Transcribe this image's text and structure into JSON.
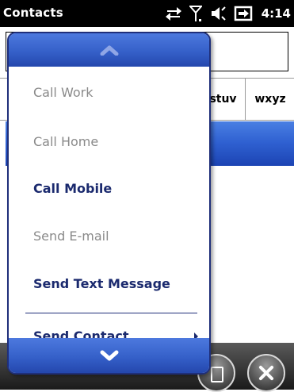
{
  "status_bar": {
    "title": "Contacts",
    "time": "4:14"
  },
  "letter_tabs": [
    "stuv",
    "wxyz"
  ],
  "popup_menu": {
    "items": [
      {
        "label": "Call Work",
        "enabled": false
      },
      {
        "label": "Call Home",
        "enabled": false
      },
      {
        "label": "Call Mobile",
        "enabled": true
      },
      {
        "label": "Send E-mail",
        "enabled": false
      },
      {
        "label": "Send Text Message",
        "enabled": true
      },
      {
        "label": "Send Contact",
        "enabled": true,
        "has_submenu": true
      }
    ],
    "scroll_up_icon": "chevron-up-icon",
    "scroll_down_icon": "chevron-down-icon",
    "submenu_icon": "triangle-right-icon"
  },
  "softkeys": {
    "menu_icon": "menu-icon",
    "close_icon": "close-icon"
  },
  "colors": {
    "menu_border": "#1f2f7a",
    "menu_enabled_text": "#1b2a6e",
    "menu_disabled_text": "#8a8a8a",
    "highlight_blue": "#3560c9"
  }
}
